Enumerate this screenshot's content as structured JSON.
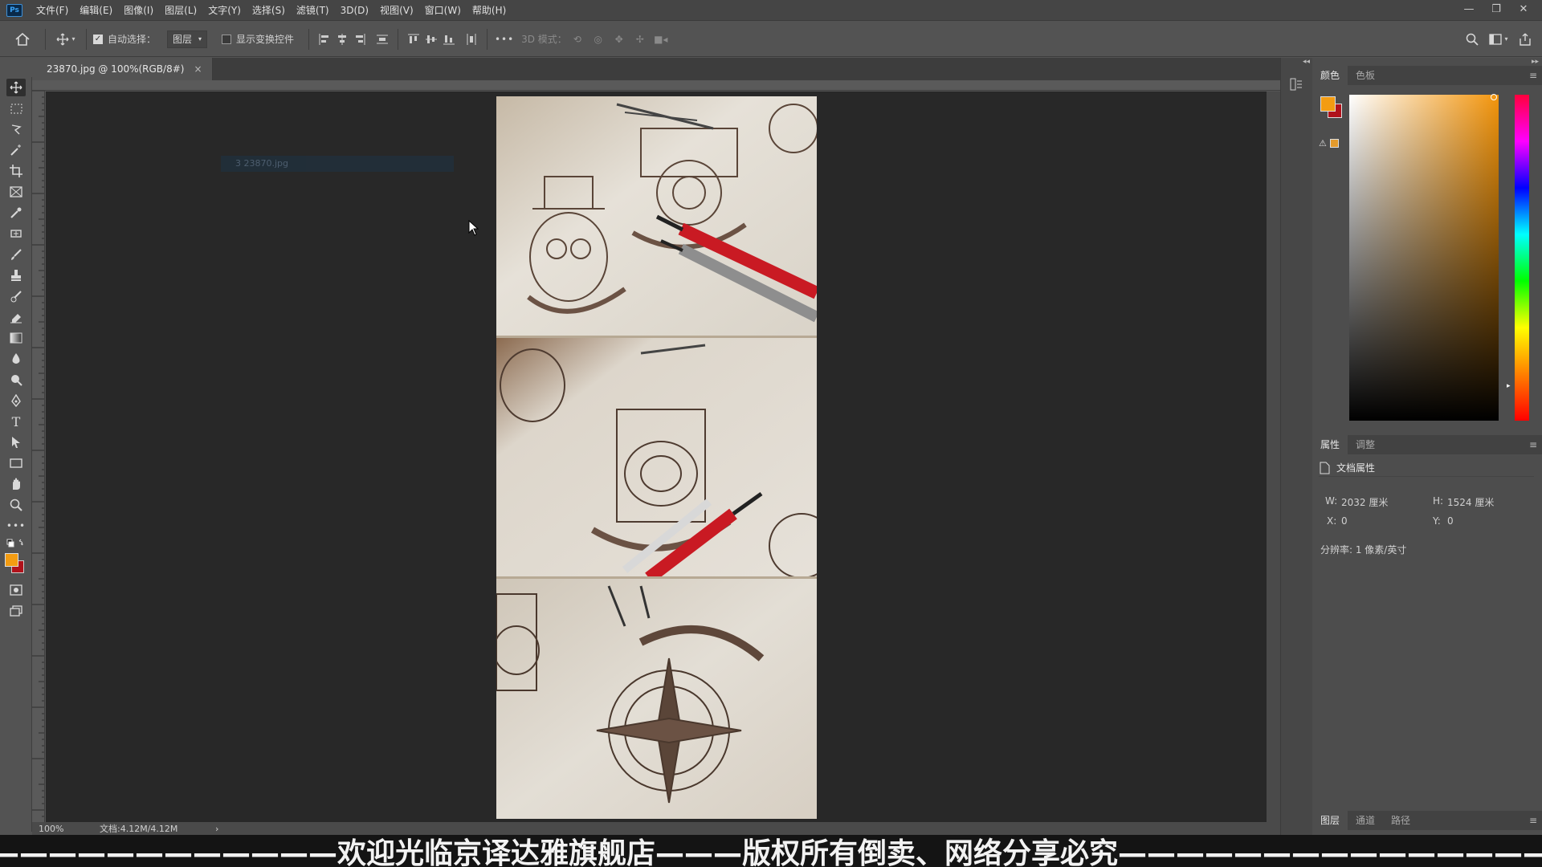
{
  "app": {
    "logo": "Ps"
  },
  "menu": [
    "文件(F)",
    "编辑(E)",
    "图像(I)",
    "图层(L)",
    "文字(Y)",
    "选择(S)",
    "滤镜(T)",
    "3D(D)",
    "视图(V)",
    "窗口(W)",
    "帮助(H)"
  ],
  "window_controls": {
    "minimize": "—",
    "restore": "❐",
    "close": "✕"
  },
  "options": {
    "auto_select_label": "自动选择：",
    "auto_select_checked": true,
    "layer_dropdown": "图层",
    "show_transform_label": "显示变换控件",
    "show_transform_checked": false,
    "more": "•••",
    "mode_3d": "3D 模式："
  },
  "document_tab": {
    "title": "23870.jpg @ 100%(RGB/8#)",
    "close": "×"
  },
  "canvas_ghost_layer": "3 23870.jpg",
  "status": {
    "zoom": "100%",
    "doc_size": "文档:4.12M/4.12M",
    "arrow": "›"
  },
  "color_panel": {
    "tabs": [
      "颜色",
      "色板"
    ],
    "foreground": "#f39c12",
    "background": "#b0121b",
    "warning_swatch": "#e39a2c"
  },
  "properties_panel": {
    "tabs": [
      "属性",
      "调整"
    ],
    "section": "文档属性",
    "w_label": "W:",
    "w_value": "2032 厘米",
    "h_label": "H:",
    "h_value": "1524 厘米",
    "x_label": "X:",
    "x_value": "0",
    "y_label": "Y:",
    "y_value": "0",
    "resolution": "分辨率: 1 像素/英寸"
  },
  "layers_panel": {
    "tabs": [
      "图层",
      "通道",
      "路径"
    ]
  },
  "subtitle": "—————————————欢迎光临京译达雅旗舰店———版权所有倒卖、网络分享必究————————————————"
}
